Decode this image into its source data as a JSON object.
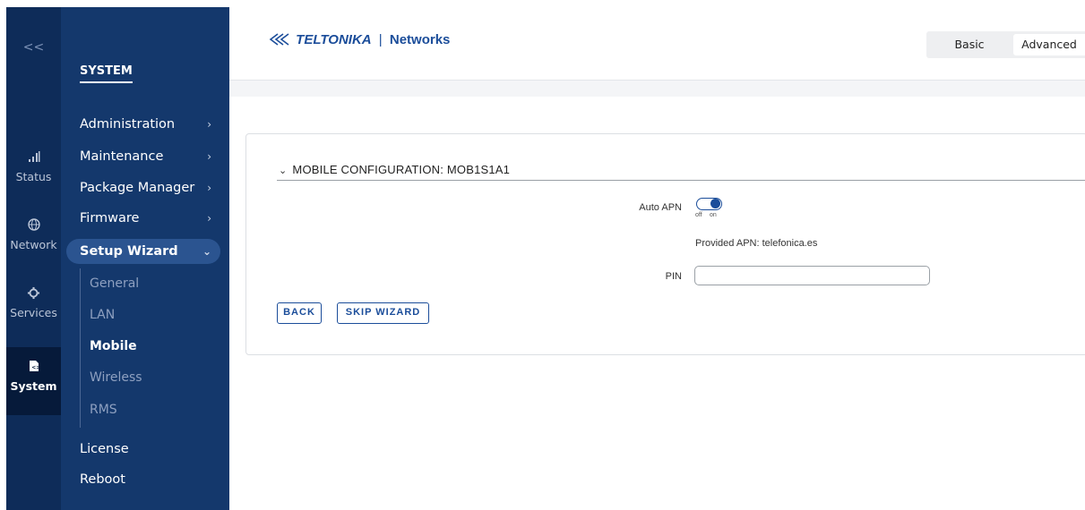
{
  "rail": {
    "collapse_glyph": "<<",
    "items": [
      {
        "label": "Status",
        "icon": "signal-icon"
      },
      {
        "label": "Network",
        "icon": "globe-icon"
      },
      {
        "label": "Services",
        "icon": "gear-icon"
      },
      {
        "label": "System",
        "icon": "system-icon",
        "active": true
      }
    ]
  },
  "menu": {
    "section_title": "SYSTEM",
    "items": [
      {
        "label": "Administration"
      },
      {
        "label": "Maintenance"
      },
      {
        "label": "Package Manager"
      },
      {
        "label": "Firmware"
      },
      {
        "label": "Setup Wizard",
        "open": true
      },
      {
        "label": "License"
      },
      {
        "label": "Reboot"
      }
    ],
    "sub_items": [
      "General",
      "LAN",
      "Mobile",
      "Wireless",
      "RMS"
    ],
    "active_sub_item": "Mobile"
  },
  "header": {
    "brand": "TELTONIKA",
    "separator": "|",
    "product": "Networks",
    "mode_basic": "Basic",
    "mode_advanced": "Advanced",
    "active_mode": "Advanced"
  },
  "card": {
    "title": "MOBILE CONFIGURATION: MOB1S1A1",
    "auto_apn_label": "Auto APN",
    "toggle_off": "off",
    "toggle_on": "on",
    "auto_apn_enabled": true,
    "apn_info": "Provided APN: telefonica.es",
    "pin_label": "PIN",
    "pin_value": "",
    "back_label": "BACK",
    "skip_label": "SKIP WIZARD"
  },
  "colors": {
    "rail_bg": "#0e2c59",
    "menu_bg": "#14386c",
    "accent": "#1b4d9a"
  }
}
